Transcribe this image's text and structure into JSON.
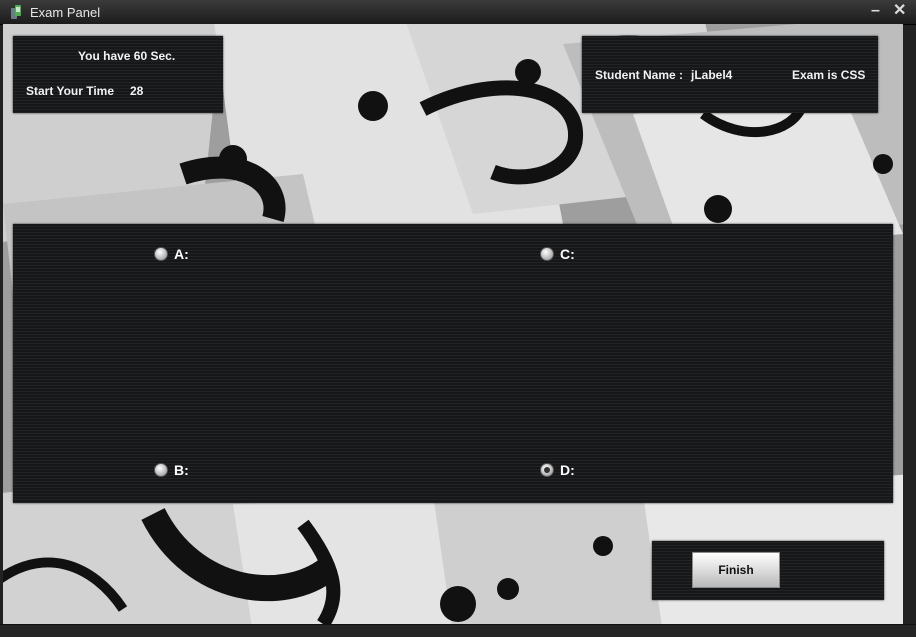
{
  "window": {
    "title": "Exam Panel",
    "minimize_label": "–",
    "close_label": "✕"
  },
  "timer": {
    "message": "You have 60 Sec.",
    "start_label": "Start Your Time",
    "value": "28"
  },
  "student": {
    "name_label": "Student Name :",
    "name_value": "jLabel4",
    "exam_label": "Exam is CSS"
  },
  "options": {
    "a_label": "A:",
    "b_label": "B:",
    "c_label": "C:",
    "d_label": "D:",
    "selected": "D"
  },
  "finish": {
    "label": "Finish"
  },
  "colors": {
    "panel": "#151719",
    "text": "#f2f2f2",
    "titlebar": "#2b2b2b"
  },
  "icons": [
    "app-icon",
    "minimize-icon",
    "close-icon",
    "radio-icon"
  ]
}
